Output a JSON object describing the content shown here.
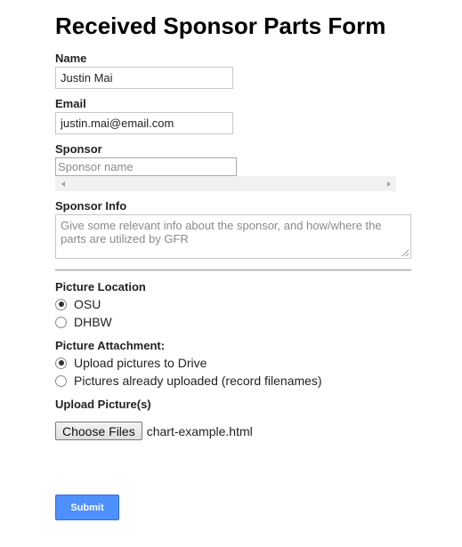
{
  "form": {
    "title": "Received Sponsor Parts Form",
    "name": {
      "label": "Name",
      "value": "Justin Mai"
    },
    "email": {
      "label": "Email",
      "value": "justin.mai@email.com"
    },
    "sponsor": {
      "label": "Sponsor",
      "placeholder": "Sponsor name",
      "value": ""
    },
    "sponsor_info": {
      "label": "Sponsor Info",
      "placeholder": "Give some relevant info about the sponsor, and how/where the parts are utilized by GFR"
    },
    "picture_location": {
      "label": "Picture Location",
      "options": [
        {
          "label": "OSU",
          "checked": true
        },
        {
          "label": "DHBW",
          "checked": false
        }
      ]
    },
    "picture_attachment": {
      "label": "Picture Attachment:",
      "options": [
        {
          "label": "Upload pictures to Drive",
          "checked": true
        },
        {
          "label": "Pictures already uploaded (record filenames)",
          "checked": false
        }
      ]
    },
    "upload": {
      "label": "Upload Picture(s)",
      "button_label": "Choose Files",
      "file_name": "chart-example.html"
    },
    "submit_label": "Submit"
  },
  "icons": {
    "scroll_left": "triangle-left",
    "scroll_right": "triangle-right"
  },
  "colors": {
    "submit_bg": "#4d90fe",
    "submit_text": "#ffffff"
  }
}
